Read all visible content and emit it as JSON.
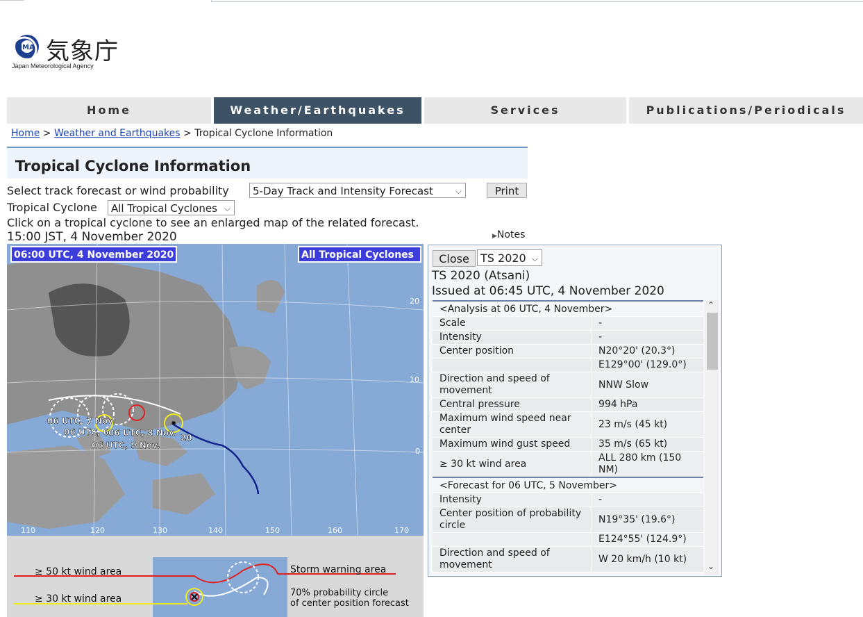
{
  "logo": {
    "kanji": "気象庁",
    "english": "Japan Meteorological Agency"
  },
  "nav": [
    {
      "label": "Home",
      "active": false
    },
    {
      "label": "Weather/Earthquakes",
      "active": true
    },
    {
      "label": "Services",
      "active": false
    },
    {
      "label": "Publications/Periodicals",
      "active": false
    }
  ],
  "breadcrumb": {
    "home": "Home",
    "sep1": ">",
    "weather": "Weather and Earthquakes",
    "sep2": ">",
    "current": "Tropical Cyclone Information"
  },
  "page_title": "Tropical Cyclone Information",
  "controls": {
    "forecast_label": "Select track forecast or wind probability",
    "forecast_value": "5-Day Track and Intensity Forecast",
    "print_label": "Print",
    "cyclone_label": "Tropical Cyclone",
    "cyclone_value": "All Tropical Cyclones",
    "instruction": "Click on a tropical cyclone to see an enlarged map of the related forecast.",
    "time_jst": "15:00 JST, 4 November 2020",
    "notes": "Notes"
  },
  "map": {
    "time_badge": "06:00 UTC, 4 November 2020",
    "filter_badge": "All Tropical Cyclones",
    "lat_labels": [
      "20",
      "10",
      "0"
    ],
    "lon_labels": [
      "110",
      "120",
      "130",
      "140",
      "150",
      "160",
      "170"
    ],
    "track_labels": [
      "06 UTC, 7 Nov.",
      "06 UTC, 6",
      "06 UTC, 8 Nov.",
      "06 UTC, 9 Nov.",
      "20"
    ]
  },
  "legend": {
    "wind50": "≥ 50 kt wind area",
    "wind30": "≥ 30 kt wind area",
    "storm": "Storm warning area",
    "prob1": "70% probability circle",
    "prob2": "of center position forecast"
  },
  "panel": {
    "close_label": "Close",
    "ts_select": "TS 2020",
    "name": "TS 2020 (Atsani)",
    "issued": "Issued at 06:45 UTC, 4 November 2020",
    "analysis_header": "<Analysis at 06 UTC, 4 November>",
    "analysis": [
      {
        "k": "Scale",
        "v": "-"
      },
      {
        "k": "Intensity",
        "v": "-"
      },
      {
        "k": "Center position",
        "v": "N20°20' (20.3°)"
      },
      {
        "k": "",
        "v": "E129°00' (129.0°)"
      },
      {
        "k": "Direction and speed of movement",
        "v": "NNW Slow"
      },
      {
        "k": "Central pressure",
        "v": "994 hPa"
      },
      {
        "k": "Maximum wind speed near center",
        "v": "23 m/s (45 kt)"
      },
      {
        "k": "Maximum wind gust speed",
        "v": "35 m/s (65 kt)"
      },
      {
        "k": "≥ 30 kt wind area",
        "v": "ALL 280 km (150 NM)"
      }
    ],
    "forecast_header": "<Forecast for 06 UTC, 5 November>",
    "forecast": [
      {
        "k": "Intensity",
        "v": "-"
      },
      {
        "k": "Center position of probability circle",
        "v": "N19°35' (19.6°)"
      },
      {
        "k": "",
        "v": "E124°55' (124.9°)"
      },
      {
        "k": "Direction and speed of movement",
        "v": "W 20 km/h (10 kt)"
      }
    ]
  }
}
